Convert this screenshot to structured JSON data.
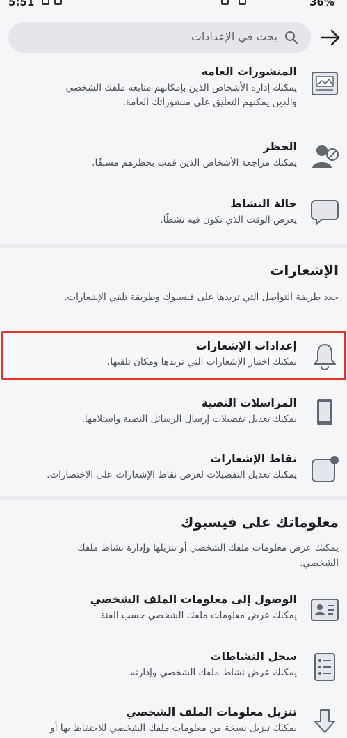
{
  "status_bar": {
    "time": "5:51",
    "battery": "36%"
  },
  "search": {
    "placeholder": "بحث في الإعدادات"
  },
  "privacy_items": [
    {
      "title": "المنشورات العامة",
      "desc_line1": "يمكنك إدارة الأشخاص الذين بإمكانهم متابعة ملفك الشخصي",
      "desc_line2": "والذين يمكنهم التعليق على منشوراتك العامة."
    },
    {
      "title": "الحظر",
      "desc_line1": "يمكنك مراجعة الأشخاص الذين قمت بحظرهم مسبقًا."
    },
    {
      "title": "حالة النشاط",
      "desc_line1": "يعرض الوقت الذي تكون فيه نشطًا."
    }
  ],
  "notifications_section": {
    "title": "الإشعارات",
    "desc": "حدد طريقة التواصل التي تريدها على فيسبوك وطريقة تلقي الإشعارات.",
    "items": [
      {
        "title": "إعدادات الإشعارات",
        "desc_line1": "يمكنك اختيار الإشعارات التي تريدها ومكان تلقيها."
      },
      {
        "title": "المراسلات النصية",
        "desc_line1": "يمكنك تعديل تفضيلات إرسال الرسائل النصية واستلامها."
      },
      {
        "title": "نقاط الإشعارات",
        "desc_line1": "يمكنك تعديل التفضيلات لعرض نقاط الإشعارات على الاختصارات."
      }
    ]
  },
  "info_section": {
    "title": "معلوماتك على فيسبوك",
    "desc_line1": "يمكنك عرض معلومات ملفك الشخصي أو تنزيلها وإدارة نشاط ملفك",
    "desc_line2": "الشخصي.",
    "items": [
      {
        "title": "الوصول إلى معلومات الملف الشخصي",
        "desc_line1": "يمكنك عرض معلومات ملفك الشخصي حسب الفئة."
      },
      {
        "title": "سجل النشاطات",
        "desc_line1": "يمكنك عرض نشاط ملفك الشخصي وإدارته."
      },
      {
        "title": "تنزيل معلومات الملف الشخصي",
        "desc_line1": "يمكنك تنزيل نسخة من معلومات ملفك الشخصي للاحتفاظ بها أو"
      }
    ]
  },
  "colors": {
    "highlight": "#e0332b",
    "icon_fill": "#e4e6eb",
    "icon_stroke": "#606770"
  }
}
